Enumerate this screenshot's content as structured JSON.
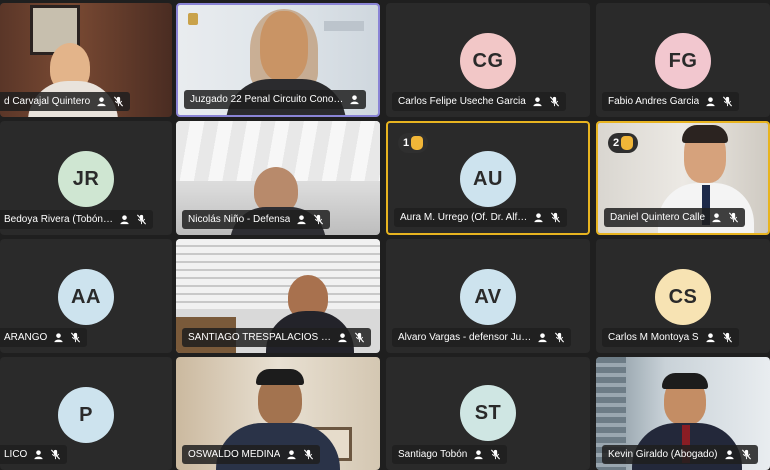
{
  "meeting": {
    "tiles": [
      {
        "name": "d Carvajal Quintero",
        "kind": "video"
      },
      {
        "name": "Juzgado 22 Penal Circuito Cono…",
        "kind": "video"
      },
      {
        "name": "Carlos Felipe Useche Garcia",
        "initials": "CG",
        "kind": "avatar",
        "color": "#f2c7c7"
      },
      {
        "name": "Fabio Andres Garcia",
        "initials": "FG",
        "kind": "avatar",
        "color": "#f2c7cf"
      },
      {
        "name": "Bedoya Rivera (Tobón…",
        "initials": "JR",
        "kind": "avatar",
        "color": "#cfe6d2"
      },
      {
        "name": "Nicolás Niño - Defensa",
        "kind": "video"
      },
      {
        "name": "Aura M. Urrego (Of. Dr. Alf…",
        "initials": "AU",
        "kind": "avatar",
        "color": "#cde3ee",
        "hand": "1"
      },
      {
        "name": "Daniel Quintero Calle",
        "kind": "video",
        "hand": "2"
      },
      {
        "name": "ARANGO",
        "initials": "AA",
        "kind": "avatar",
        "color": "#cde3ee"
      },
      {
        "name": "SANTIAGO TRESPALACIOS …",
        "kind": "video"
      },
      {
        "name": "Alvaro Vargas - defensor Ju…",
        "initials": "AV",
        "kind": "avatar",
        "color": "#cde3ee"
      },
      {
        "name": "Carlos M Montoya S",
        "initials": "CS",
        "kind": "avatar",
        "color": "#f7e3b3"
      },
      {
        "name": "LICO",
        "initials": "P",
        "kind": "avatar",
        "color": "#cde3ee"
      },
      {
        "name": "OSWALDO MEDINA",
        "kind": "video"
      },
      {
        "name": "Santiago Tobón",
        "initials": "ST",
        "kind": "avatar",
        "color": "#cfe6e3"
      },
      {
        "name": "Kevin Giraldo (Abogado)",
        "kind": "video"
      }
    ]
  }
}
